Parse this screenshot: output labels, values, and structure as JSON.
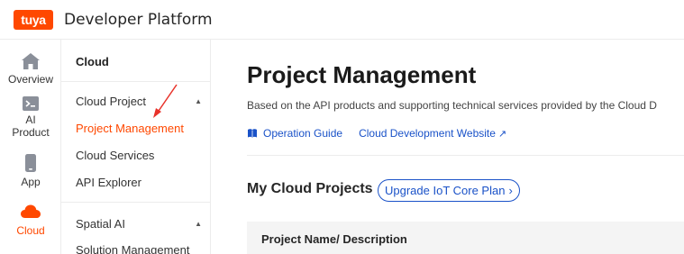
{
  "brand": {
    "logo_text": "tuya",
    "title": "Developer Platform",
    "accent": "#ff4800",
    "link_color": "#1a52c8"
  },
  "rail": {
    "items": [
      {
        "label": "Overview",
        "icon": "home-icon"
      },
      {
        "label": "AI Product",
        "icon": "terminal-icon"
      },
      {
        "label": "App",
        "icon": "phone-icon"
      },
      {
        "label": "Cloud",
        "icon": "cloud-icon",
        "active": true
      }
    ]
  },
  "submenu": {
    "root": "Cloud",
    "groups": [
      {
        "label": "Cloud Project",
        "items": [
          {
            "label": "Project Management",
            "active": true
          },
          {
            "label": "Cloud Services"
          },
          {
            "label": "API Explorer"
          }
        ]
      },
      {
        "label": "Spatial AI",
        "items": [
          {
            "label": "Solution Management"
          }
        ]
      }
    ]
  },
  "main": {
    "title": "Project Management",
    "description": "Based on the API products and supporting technical services provided by the Cloud D",
    "links": {
      "guide": "Operation Guide",
      "website": "Cloud Development Website"
    },
    "section_title": "My Cloud Projects",
    "upgrade_button": "Upgrade IoT Core Plan",
    "table": {
      "columns": [
        "Project Name/ Description"
      ]
    }
  }
}
